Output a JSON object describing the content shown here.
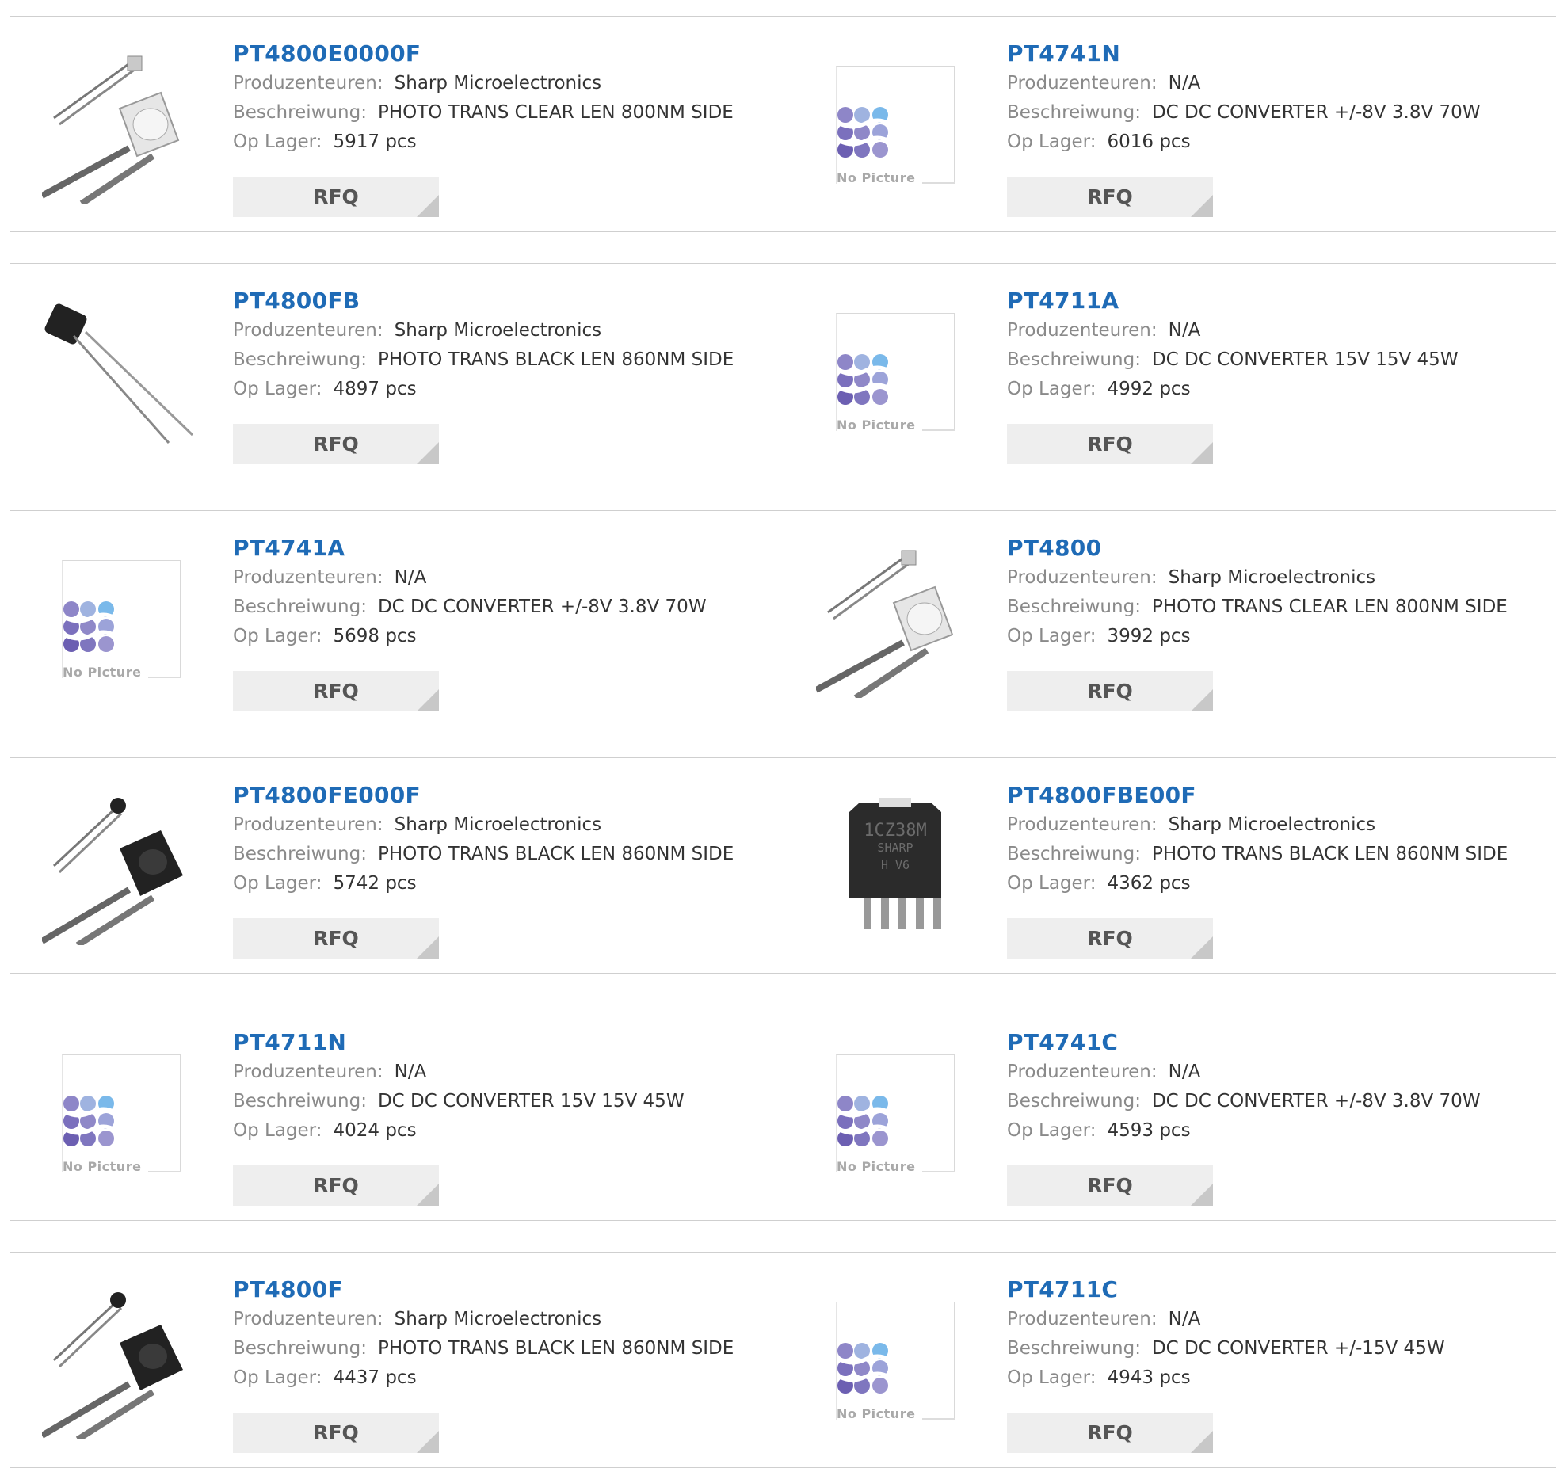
{
  "labels": {
    "manufacturer": "Produzenteuren:",
    "description": "Beschreiwung:",
    "stock": "Op Lager:",
    "rfq": "RFQ",
    "no_picture": "No Picture"
  },
  "colors": {
    "part_link": "#1f6bb6",
    "label": "#8a8a8a",
    "button_bg": "#eeeeee"
  },
  "products": [
    {
      "part": "PT4800E0000F",
      "manufacturer": "Sharp Microelectronics",
      "description": "PHOTO TRANS CLEAR LEN 800NM SIDE",
      "stock": "5917 pcs",
      "image": "clear-phototransistor"
    },
    {
      "part": "PT4741N",
      "manufacturer": "N/A",
      "description": "DC DC CONVERTER +/-8V 3.8V 70W",
      "stock": "6016 pcs",
      "image": "no-picture"
    },
    {
      "part": "PT4800FB",
      "manufacturer": "Sharp Microelectronics",
      "description": "PHOTO TRANS BLACK LEN 860NM SIDE",
      "stock": "4897 pcs",
      "image": "black-small-phototransistor"
    },
    {
      "part": "PT4711A",
      "manufacturer": "N/A",
      "description": "DC DC CONVERTER 15V 15V 45W",
      "stock": "4992 pcs",
      "image": "no-picture"
    },
    {
      "part": "PT4741A",
      "manufacturer": "N/A",
      "description": "DC DC CONVERTER +/-8V 3.8V 70W",
      "stock": "5698 pcs",
      "image": "no-picture"
    },
    {
      "part": "PT4800",
      "manufacturer": "Sharp Microelectronics",
      "description": "PHOTO TRANS CLEAR LEN 800NM SIDE",
      "stock": "3992 pcs",
      "image": "clear-phototransistor"
    },
    {
      "part": "PT4800FE000F",
      "manufacturer": "Sharp Microelectronics",
      "description": "PHOTO TRANS BLACK LEN 860NM SIDE",
      "stock": "5742 pcs",
      "image": "black-phototransistor"
    },
    {
      "part": "PT4800FBE00F",
      "manufacturer": "Sharp Microelectronics",
      "description": "PHOTO TRANS BLACK LEN 860NM SIDE",
      "stock": "4362 pcs",
      "image": "sharp-ic-package"
    },
    {
      "part": "PT4711N",
      "manufacturer": "N/A",
      "description": "DC DC CONVERTER 15V 15V 45W",
      "stock": "4024 pcs",
      "image": "no-picture"
    },
    {
      "part": "PT4741C",
      "manufacturer": "N/A",
      "description": "DC DC CONVERTER +/-8V 3.8V 70W",
      "stock": "4593 pcs",
      "image": "no-picture"
    },
    {
      "part": "PT4800F",
      "manufacturer": "Sharp Microelectronics",
      "description": "PHOTO TRANS BLACK LEN 860NM SIDE",
      "stock": "4437 pcs",
      "image": "black-phototransistor"
    },
    {
      "part": "PT4711C",
      "manufacturer": "N/A",
      "description": "DC DC CONVERTER +/-15V 45W",
      "stock": "4943 pcs",
      "image": "no-picture"
    }
  ],
  "chip_marking": [
    "1CZ38M",
    "SHARP",
    "H   V6"
  ]
}
